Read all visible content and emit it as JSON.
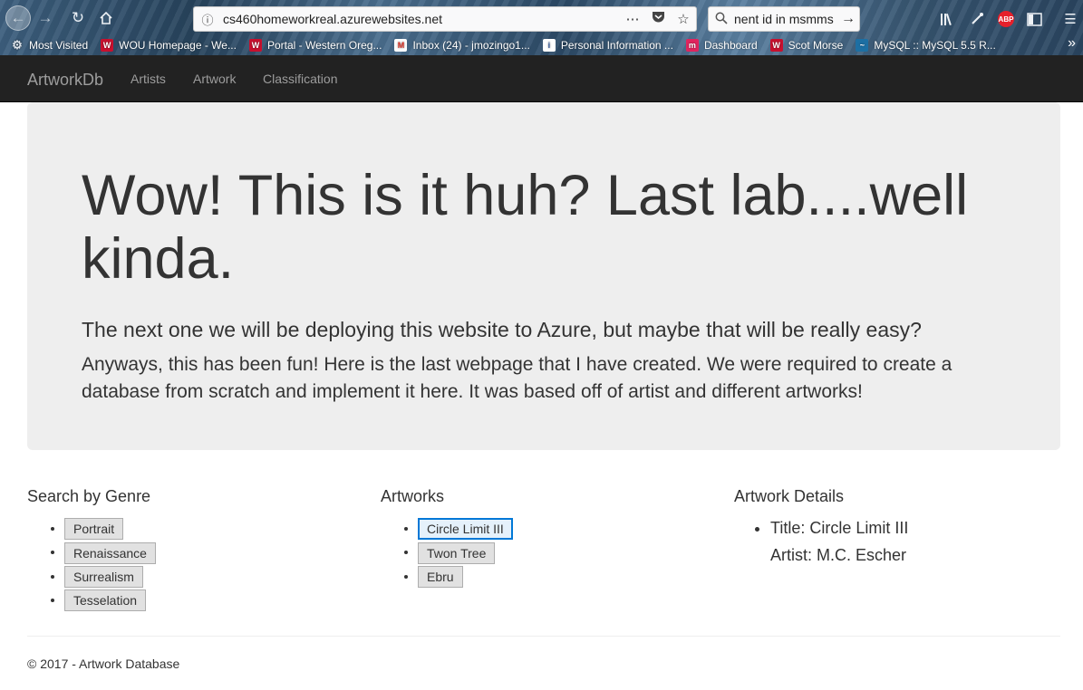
{
  "browser": {
    "url": "cs460homeworkreal.azurewebsites.net",
    "search_text": "nent id in msmms",
    "bookmarks": [
      {
        "label": "Most Visited",
        "color": "#9aa7b3",
        "icon": "gear-icon"
      },
      {
        "label": "WOU Homepage - We...",
        "color": "#c8102e",
        "icon": "shield-icon"
      },
      {
        "label": "Portal - Western Oreg...",
        "color": "#c8102e",
        "icon": "shield-icon"
      },
      {
        "label": "Inbox (24) - jmozingo1...",
        "color": "#d93025",
        "icon": "mail-icon"
      },
      {
        "label": "Personal Information ...",
        "color": "#2f5597",
        "icon": "doc-icon"
      },
      {
        "label": "Dashboard",
        "color": "#e0245e",
        "icon": "m-icon"
      },
      {
        "label": "Scot Morse",
        "color": "#c8102e",
        "icon": "shield-icon"
      },
      {
        "label": "MySQL :: MySQL 5.5 R...",
        "color": "#1d6fa3",
        "icon": "dolphin-icon"
      }
    ]
  },
  "navbar": {
    "brand": "ArtworkDb",
    "links": [
      "Artists",
      "Artwork",
      "Classification"
    ]
  },
  "jumbotron": {
    "heading": "Wow! This is it huh? Last lab....well kinda.",
    "lead": "The next one we will be deploying this website to Azure, but maybe that will be really easy?",
    "body": "Anyways, this has been fun! Here is the last webpage that I have created. We were required to create a database from scratch and implement it here. It was based off of artist and different artworks!"
  },
  "genres": {
    "title": "Search by Genre",
    "items": [
      "Portrait",
      "Renaissance",
      "Surrealism",
      "Tesselation"
    ]
  },
  "artworks": {
    "title": "Artworks",
    "items": [
      "Circle Limit III",
      "Twon Tree",
      "Ebru"
    ],
    "focused_index": 0
  },
  "details": {
    "title": "Artwork Details",
    "title_line": "Title: Circle Limit III",
    "artist_line": "Artist: M.C. Escher"
  },
  "footer": {
    "text": "© 2017 - Artwork Database"
  }
}
